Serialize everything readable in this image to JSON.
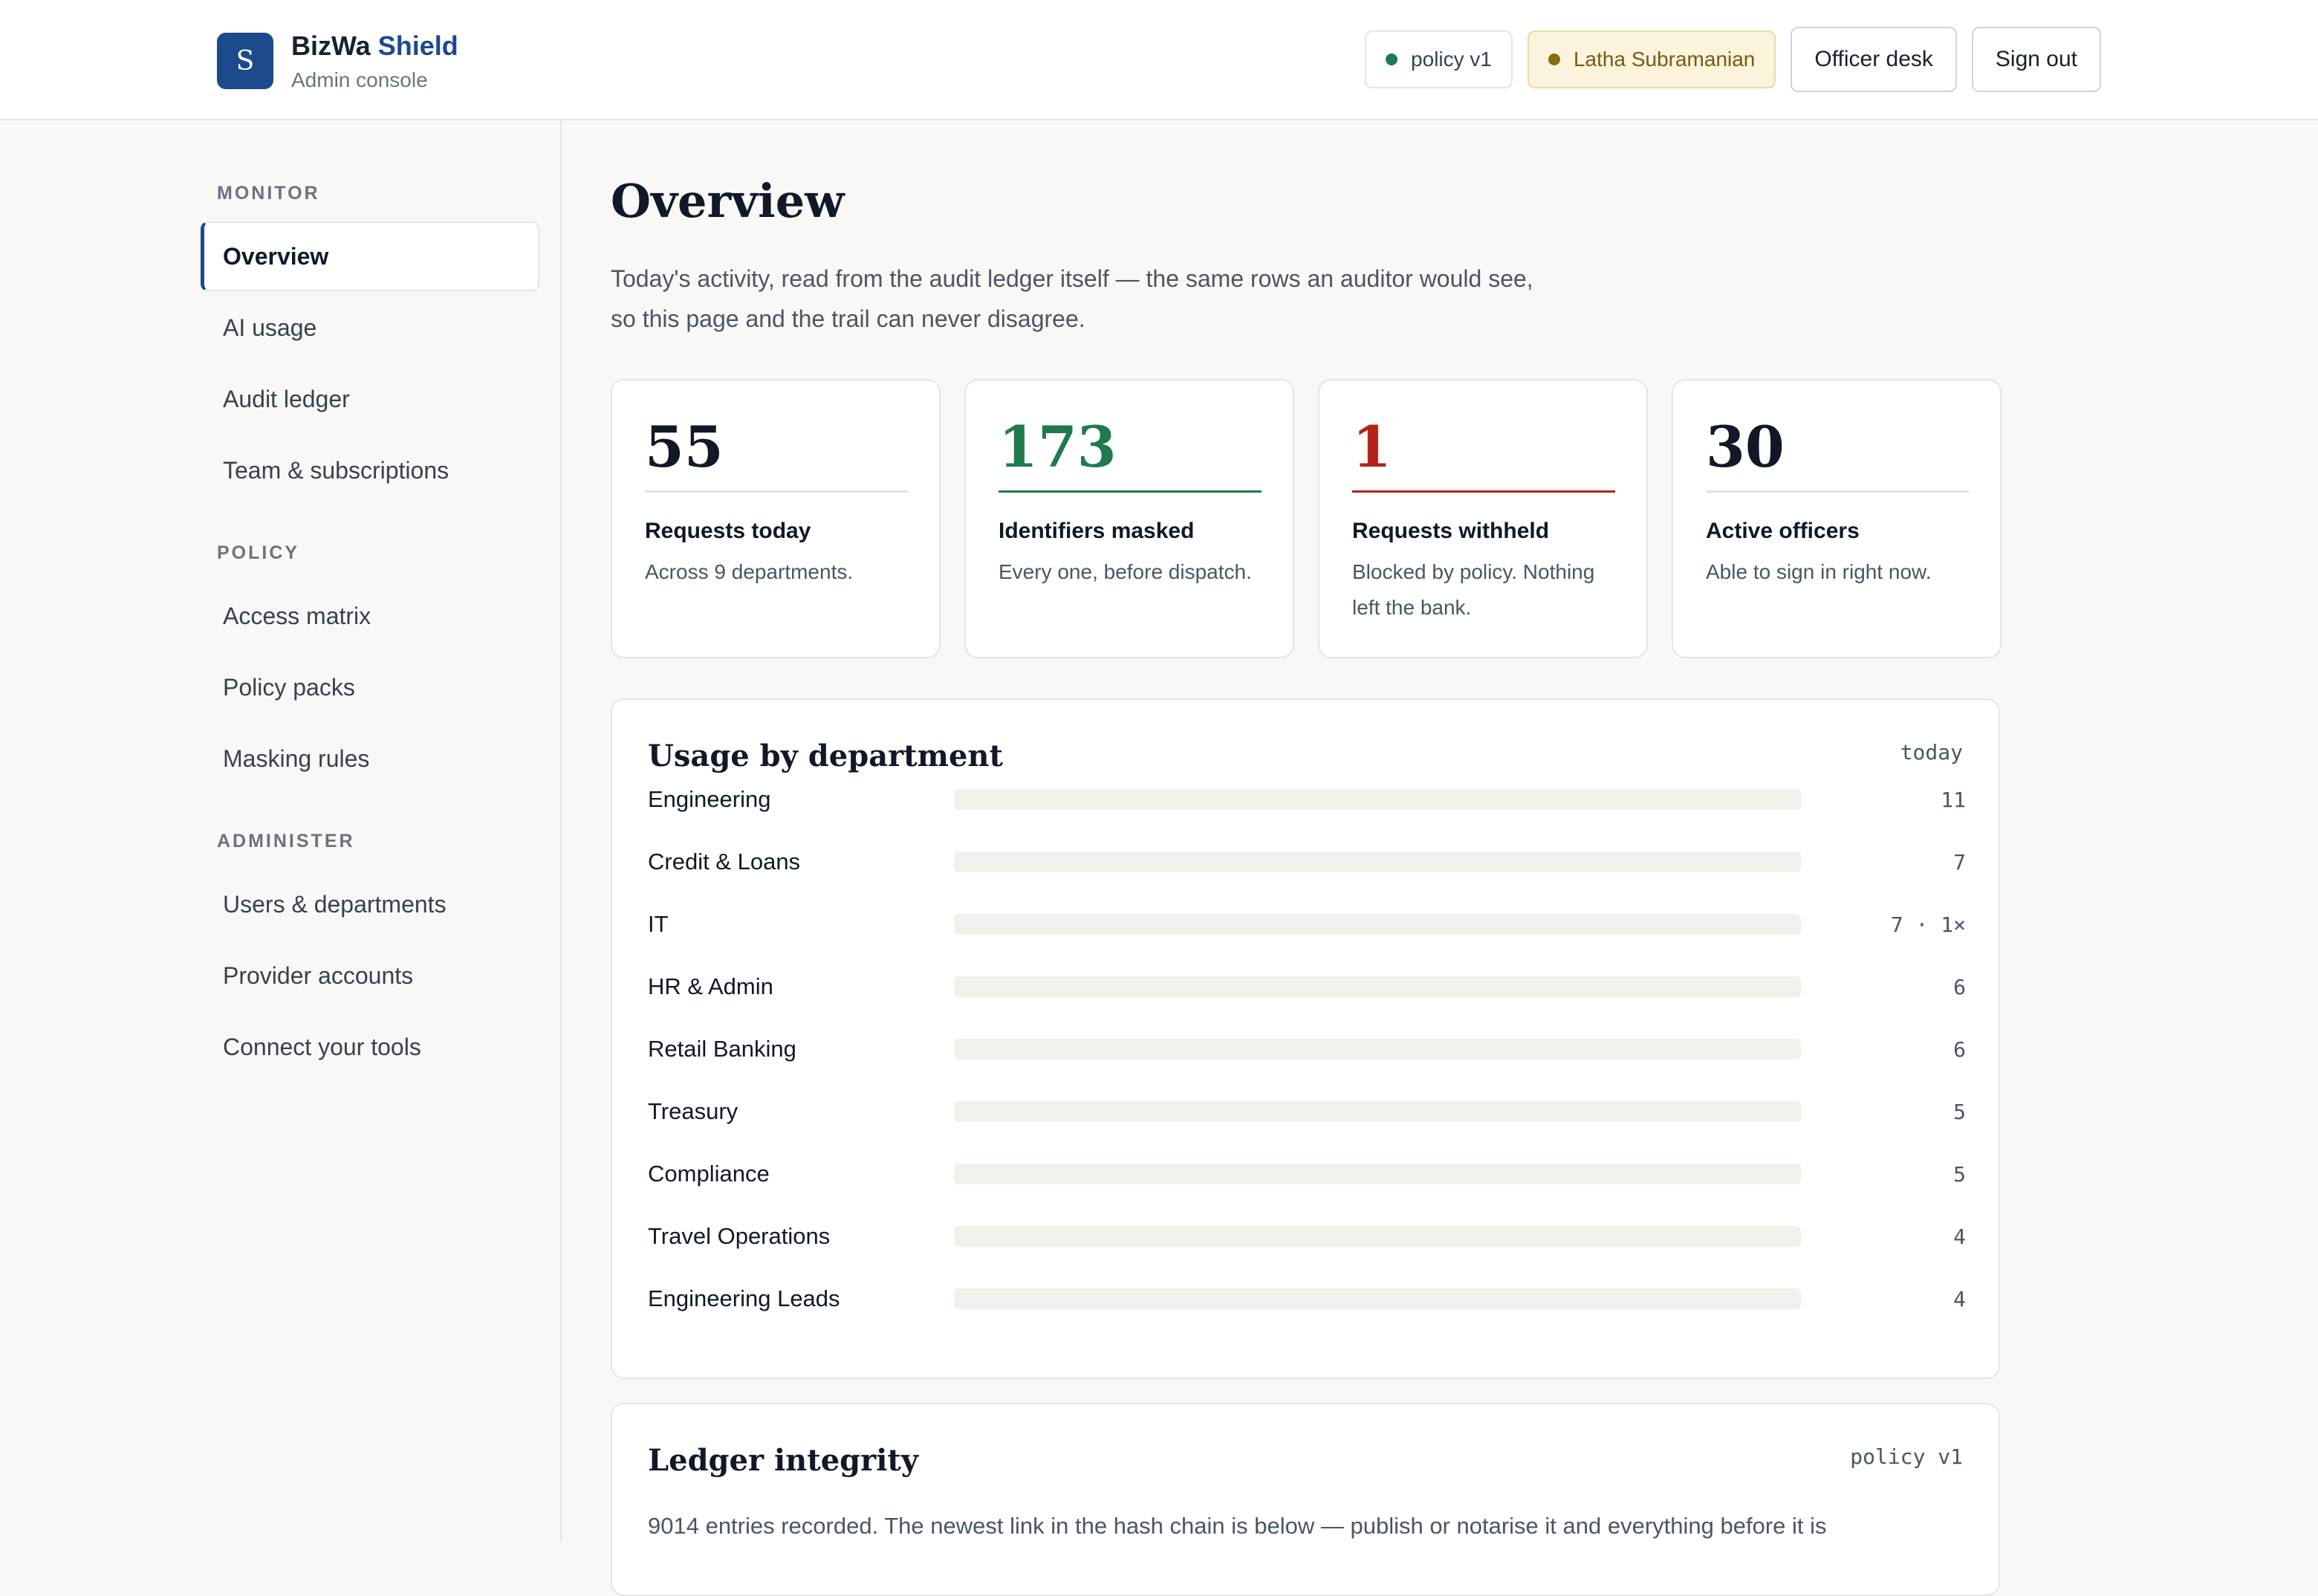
{
  "brand": {
    "name": "BizWa",
    "name_accent": "Shield",
    "logo_letter": "S",
    "subtitle": "Admin console"
  },
  "header": {
    "policy_pill": "policy v1",
    "user_pill": "Latha Subramanian",
    "officer_desk_label": "Officer desk",
    "sign_out_label": "Sign out"
  },
  "sidebar": {
    "sections": [
      {
        "label": "MONITOR",
        "items": [
          "Overview",
          "AI usage",
          "Audit ledger",
          "Team & subscriptions"
        ]
      },
      {
        "label": "POLICY",
        "items": [
          "Access matrix",
          "Policy packs",
          "Masking rules"
        ]
      },
      {
        "label": "ADMINISTER",
        "items": [
          "Users & departments",
          "Provider accounts",
          "Connect your tools"
        ]
      }
    ],
    "active_item": "Overview"
  },
  "page": {
    "title": "Overview",
    "description_line1": "Today's activity, read from the audit ledger itself — the same rows an auditor would see,",
    "description_line2": "so this page and the trail can never disagree."
  },
  "stats": [
    {
      "value": "55",
      "label": "Requests today",
      "sub": "Across 9 departments.",
      "color": "#111827",
      "rule": "#dfe3e8"
    },
    {
      "value": "173",
      "label": "Identifiers masked",
      "sub": "Every one, before dispatch.",
      "color": "#1f7a4d",
      "rule": "#1f7a4d"
    },
    {
      "value": "1",
      "label": "Requests withheld",
      "sub": "Blocked by policy. Nothing left the bank.",
      "color": "#b42318",
      "rule": "#b42318"
    },
    {
      "value": "30",
      "label": "Active officers",
      "sub": "Able to sign in right now.",
      "color": "#111827",
      "rule": "#dfe3e8"
    }
  ],
  "usage": {
    "title": "Usage by department",
    "tag": "today",
    "rows": [
      {
        "name": "Engineering",
        "value": 11,
        "display": "11"
      },
      {
        "name": "Credit & Loans",
        "value": 7,
        "display": "7"
      },
      {
        "name": "IT",
        "value": 7,
        "display": "7 · 1×"
      },
      {
        "name": "HR & Admin",
        "value": 6,
        "display": "6"
      },
      {
        "name": "Retail Banking",
        "value": 6,
        "display": "6"
      },
      {
        "name": "Treasury",
        "value": 5,
        "display": "5"
      },
      {
        "name": "Compliance",
        "value": 5,
        "display": "5"
      },
      {
        "name": "Travel Operations",
        "value": 4,
        "display": "4"
      },
      {
        "name": "Engineering Leads",
        "value": 4,
        "display": "4"
      }
    ]
  },
  "ledger": {
    "title": "Ledger integrity",
    "tag": "policy v1",
    "text": "9014 entries recorded. The newest link in the hash chain is below — publish or notarise it and everything before it is"
  },
  "colors": {
    "accent": "#1c4a8c",
    "ok_dot": "#1f7a4d",
    "user_dot": "#8a6a12"
  }
}
